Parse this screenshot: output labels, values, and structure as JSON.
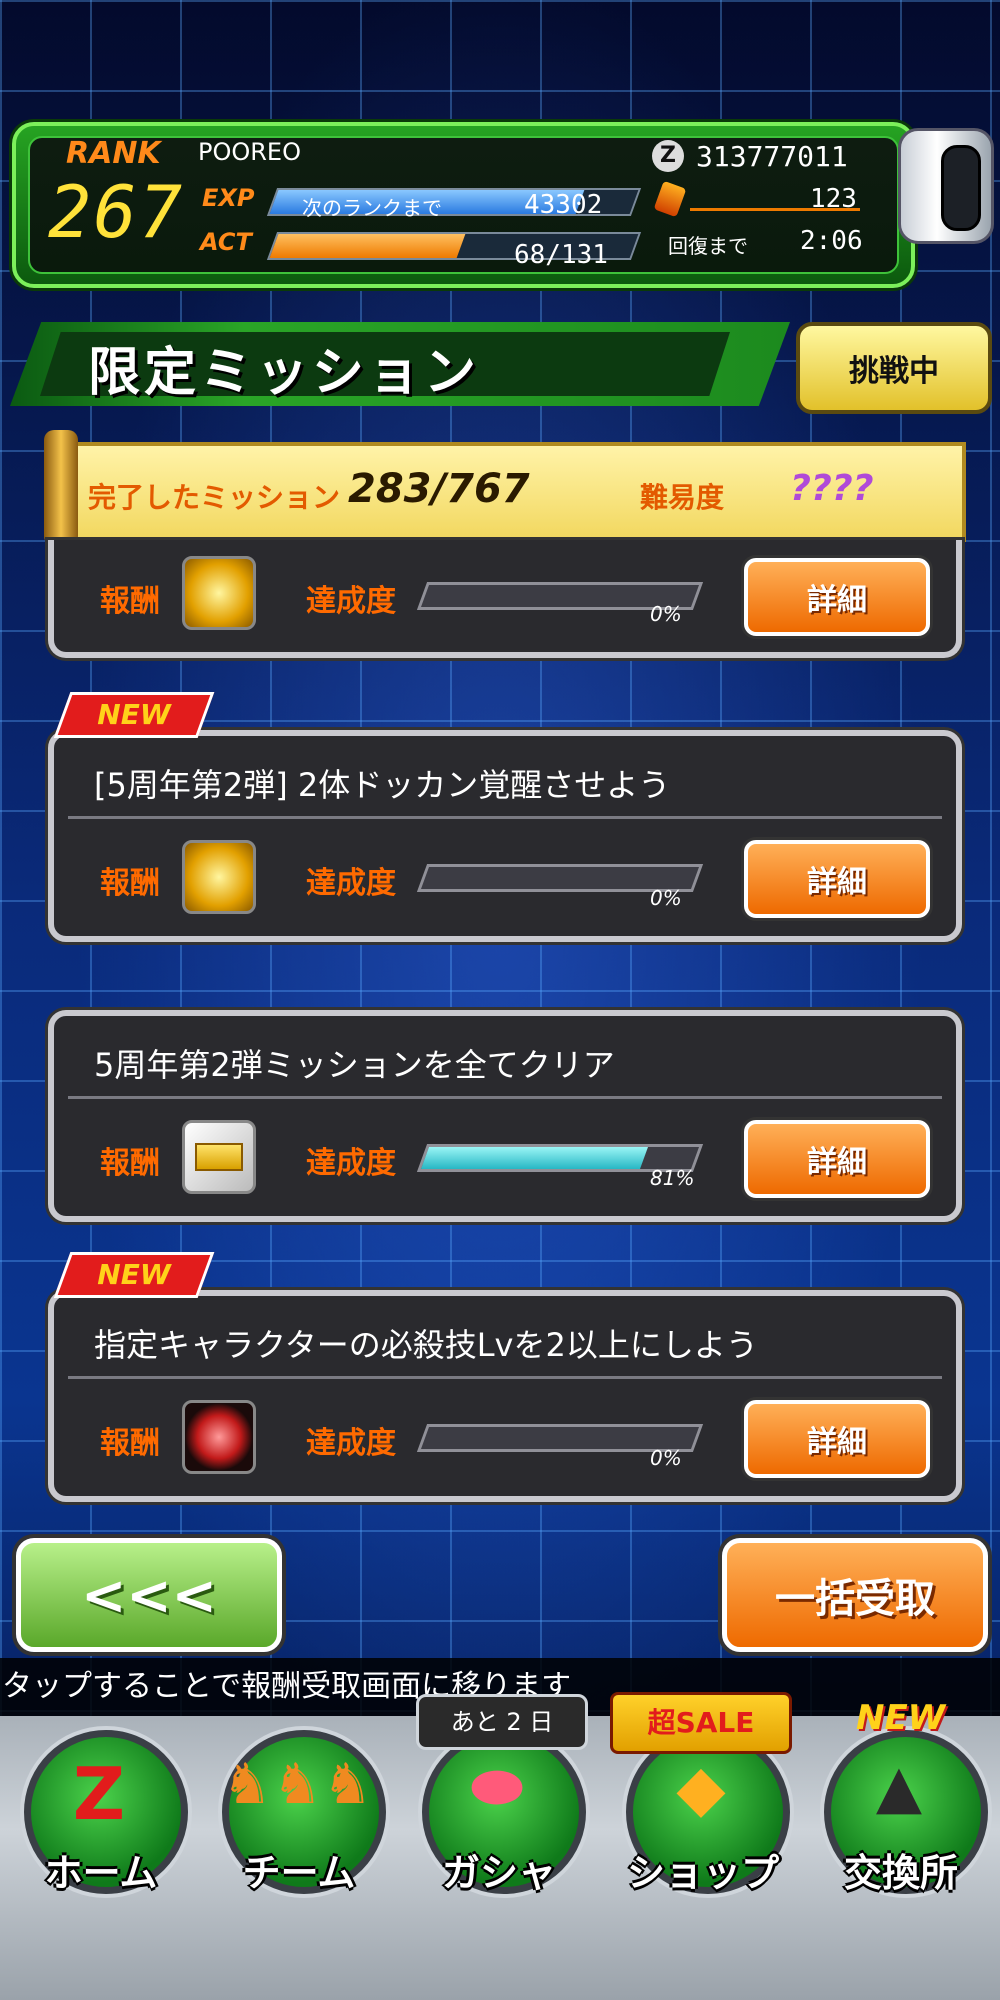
{
  "header": {
    "rank_label": "RANK",
    "rank": "267",
    "player_name": "POOREO",
    "exp_label": "EXP",
    "exp_next_text": "次のランクまで",
    "exp_remaining": "43302",
    "exp_progress": 0.85,
    "act_label": "ACT",
    "act_value": "68/131",
    "act_progress": 0.52,
    "zeni": "313777011",
    "stones": "123",
    "recover_label": "回復まで",
    "recover_time": "2:06"
  },
  "page": {
    "title": "限定ミッション",
    "status_button": "挑戦中",
    "completed_label": "完了したミッション",
    "completed_count": "283/767",
    "difficulty_label": "難易度",
    "difficulty_value": "????"
  },
  "missions": [
    {
      "new": "",
      "title": "",
      "reward_label": "報酬",
      "achieve_label": "達成度",
      "percent": "0%",
      "progress": 0,
      "detail": "詳細",
      "reward_icon": "anniversary-medal-icon"
    },
    {
      "new": "NEW",
      "title": "[5周年第2弾] 2体ドッカン覚醒させよう",
      "reward_label": "報酬",
      "achieve_label": "達成度",
      "percent": "0%",
      "progress": 0,
      "detail": "詳細",
      "reward_icon": "anniversary-medal-icon"
    },
    {
      "new": "",
      "title": "5周年第2弾ミッションを全てクリア",
      "reward_label": "報酬",
      "achieve_label": "達成度",
      "percent": "81%",
      "progress": 0.81,
      "detail": "詳細",
      "reward_icon": "gold-ticket-icon"
    },
    {
      "new": "NEW",
      "title": "指定キャラクターの必殺技Lvを2以上にしよう",
      "reward_label": "報酬",
      "achieve_label": "達成度",
      "percent": "0%",
      "progress": 0,
      "detail": "詳細",
      "reward_icon": "red-orb-icon"
    }
  ],
  "footer": {
    "back_label": "<<<",
    "claim_all": "一括受取",
    "hint": "タップすることで報酬受取画面に移ります"
  },
  "nav": {
    "home": "ホーム",
    "team": "チーム",
    "gacha": "ガシャ",
    "shop": "ショップ",
    "exchange": "交換所",
    "gacha_tag": "あと 2 日",
    "sale_tag": "超SALE",
    "new_tag": "NEW"
  },
  "colors": {
    "accent_orange": "#ee6a00",
    "header_green": "#26a322",
    "bar_cyan": "#27b7c4"
  }
}
